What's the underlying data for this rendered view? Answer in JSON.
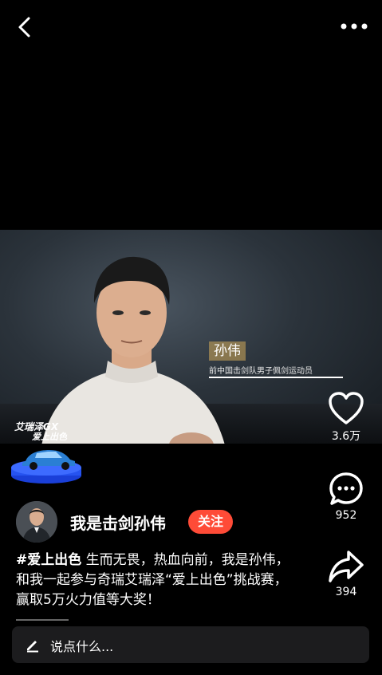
{
  "video_overlay": {
    "person_name": "孙伟",
    "person_title": "前中国击剑队男子佩剑运动员",
    "brand_line1": "艾瑞泽GX",
    "brand_line2": "爱上出色"
  },
  "actions": {
    "likes": "3.6万",
    "comments": "952",
    "shares": "394"
  },
  "author": {
    "username": "我是击剑孙伟",
    "follow_label": "关注"
  },
  "caption": {
    "hashtag": "#爱上出色",
    "text": " 生而无畏，热血向前，我是孙伟，和我一起参与奇瑞艾瑞泽“爱上出色”挑战赛，赢取5万火力值等大奖！"
  },
  "comment_bar": {
    "placeholder": "说点什么..."
  },
  "colors": {
    "follow_button": "#fe4b37",
    "background": "#000000"
  },
  "icons": [
    "back-arrow-icon",
    "more-icon",
    "heart-icon",
    "comment-icon",
    "share-icon",
    "pen-icon"
  ]
}
